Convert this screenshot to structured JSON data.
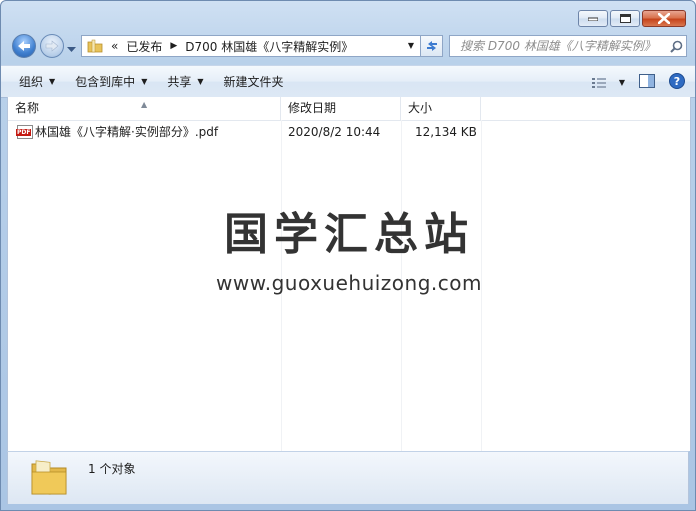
{
  "breadcrumb": {
    "overflow": "«",
    "segments": [
      "已发布",
      "D700 林国雄《八字精解实例》"
    ]
  },
  "search": {
    "placeholder": "搜索 D700 林国雄《八字精解实例》"
  },
  "toolbar": {
    "organize": "组织",
    "include_library": "包含到库中",
    "share": "共享",
    "new_folder": "新建文件夹"
  },
  "columns": {
    "name": "名称",
    "date": "修改日期",
    "size": "大小"
  },
  "files": [
    {
      "name": "林国雄《八字精解·实例部分》.pdf",
      "date": "2020/8/2 10:44",
      "size": "12,134 KB",
      "icon": "pdf-icon"
    }
  ],
  "watermark": {
    "title": "国学汇总站",
    "url": "www.guoxuehuizong.com"
  },
  "status": {
    "count": "1 个对象"
  },
  "colors": {
    "frame": "#b9d1ea",
    "pdf_badge": "#c41a12",
    "back_button": "#3f7fcf"
  }
}
